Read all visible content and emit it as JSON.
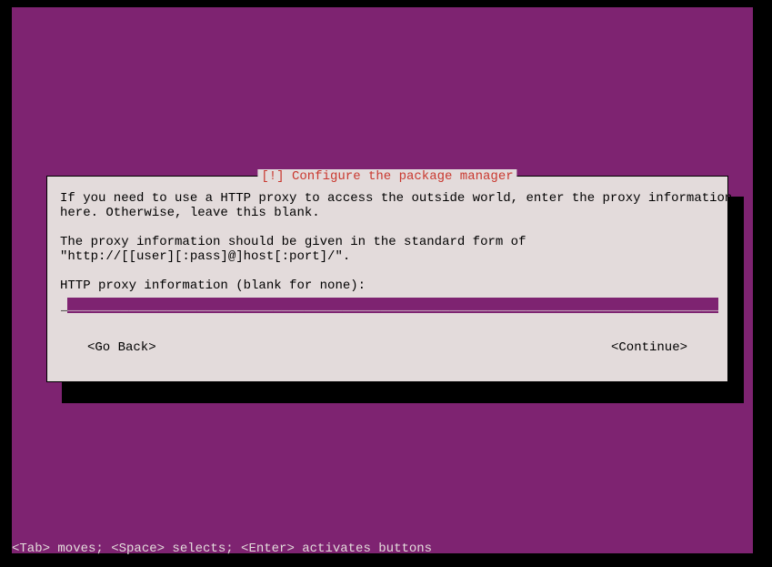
{
  "dialog": {
    "title": "[!] Configure the package manager",
    "desc1": "If you need to use a HTTP proxy to access the outside world, enter the proxy information",
    "desc2": "here. Otherwise, leave this blank.",
    "desc3": "The proxy information should be given in the standard form of",
    "desc4": "\"http://[[user][:pass]@]host[:port]/\".",
    "field_label": "HTTP proxy information (blank for none):",
    "input_value": "",
    "go_back": "<Go Back>",
    "continue": "<Continue>"
  },
  "footer": "<Tab> moves; <Space> selects; <Enter> activates buttons"
}
